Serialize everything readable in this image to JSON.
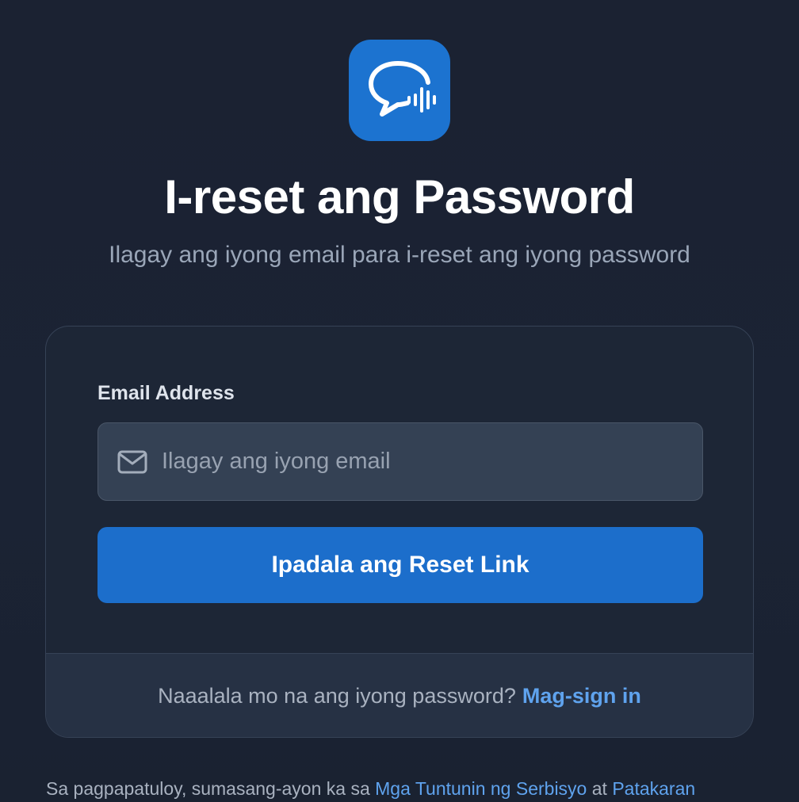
{
  "app": {
    "logo_icon": "chat-voice-icon",
    "brand_color": "#1c73d0"
  },
  "header": {
    "title": "I-reset ang Password",
    "subtitle": "Ilagay ang iyong email para i-reset ang iyong password"
  },
  "form": {
    "email_label": "Email Address",
    "email_placeholder": "Ilagay ang iyong email",
    "email_value": "",
    "email_icon": "mail-icon",
    "submit_label": "Ipadala ang Reset Link"
  },
  "footer": {
    "remember_text": "Naaalala mo na ang iyong password?",
    "signin_link": "Mag-sign in"
  },
  "terms": {
    "prefix": "Sa pagpapatuloy, sumasang-ayon ka sa",
    "terms_link": "Mga Tuntunin ng Serbisyo",
    "conjunction": "at",
    "policy_link": "Patakaran"
  },
  "colors": {
    "background": "#1b2232",
    "card": "#1d2636",
    "accent": "#1c6ecb",
    "link": "#5fa3ee"
  }
}
